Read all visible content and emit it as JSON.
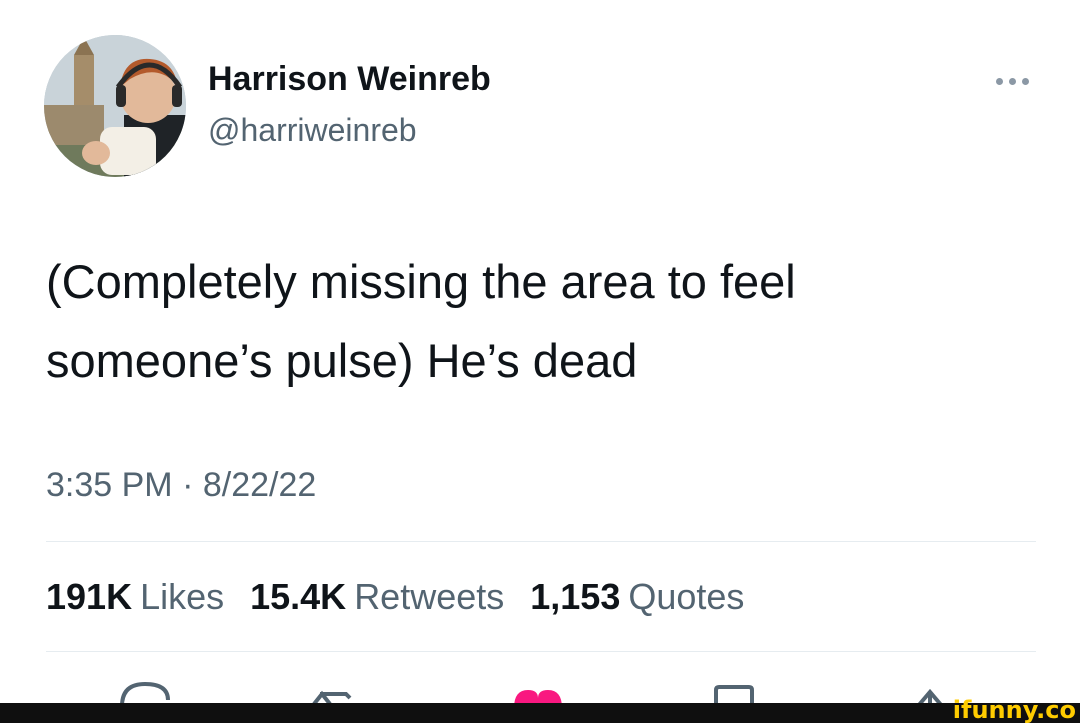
{
  "author": {
    "name": "Harrison Weinreb",
    "handle": "@harriweinreb"
  },
  "tweet": {
    "text_line1": "(Completely missing the area to feel",
    "text_line2": "someone’s pulse) He’s dead",
    "timestamp": "3:35 PM · 8/22/22"
  },
  "stats": {
    "likes_count": "191K",
    "likes_label": "Likes",
    "retweets_count": "15.4K",
    "retweets_label": "Retweets",
    "quotes_count": "1,153",
    "quotes_label": "Quotes"
  },
  "actions": [
    "reply-icon",
    "retweet-icon",
    "like-icon",
    "bookmark-icon",
    "share-icon"
  ],
  "watermark": "ifunny.co",
  "colors": {
    "text": "#0f1419",
    "secondary": "#536471",
    "like": "#f91880",
    "divider": "#e6ecf0",
    "watermark": "#ffcc00"
  }
}
